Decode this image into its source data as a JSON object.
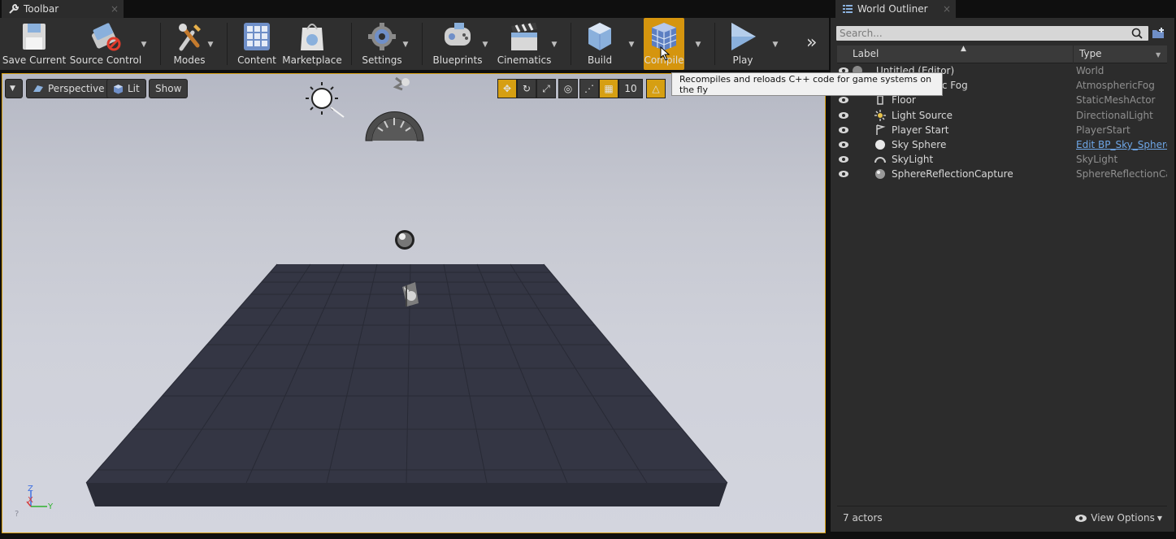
{
  "left_tab": {
    "title": "Toolbar",
    "close": "×"
  },
  "right_tab": {
    "title": "World Outliner",
    "close": "×"
  },
  "toolbar": {
    "buttons": [
      {
        "label": "Save Current",
        "icon": "save-icon"
      },
      {
        "label": "Source Control",
        "icon": "source-control-icon"
      },
      {
        "label": "Modes",
        "icon": "modes-icon"
      },
      {
        "label": "Content",
        "icon": "content-icon"
      },
      {
        "label": "Marketplace",
        "icon": "marketplace-icon"
      },
      {
        "label": "Settings",
        "icon": "settings-icon"
      },
      {
        "label": "Blueprints",
        "icon": "blueprints-icon"
      },
      {
        "label": "Cinematics",
        "icon": "cinematics-icon"
      },
      {
        "label": "Build",
        "icon": "build-icon"
      },
      {
        "label": "Compile",
        "icon": "compile-icon"
      },
      {
        "label": "Play",
        "icon": "play-icon"
      }
    ],
    "overflow": "»",
    "tooltip": "Recompiles and reloads C++ code for game systems on the fly"
  },
  "viewport": {
    "view_mode": "Perspective",
    "lighting": "Lit",
    "show": "Show",
    "grid_value": "10",
    "axis": {
      "z": "Z",
      "x": "X",
      "y": "Y"
    },
    "help": "?"
  },
  "outliner": {
    "search_placeholder": "Search...",
    "col_label": "Label",
    "col_type": "Type",
    "rows": [
      {
        "label": "Untitled (Editor)",
        "type": "World"
      },
      {
        "label": "Atmospheric Fog",
        "type": "AtmosphericFog"
      },
      {
        "label": "Floor",
        "type": "StaticMeshActor"
      },
      {
        "label": "Light Source",
        "type": "DirectionalLight"
      },
      {
        "label": "Player Start",
        "type": "PlayerStart"
      },
      {
        "label": "Sky Sphere",
        "type": "Edit BP_Sky_Sphere"
      },
      {
        "label": "SkyLight",
        "type": "SkyLight"
      },
      {
        "label": "SphereReflectionCapture",
        "type": "SphereReflectionCapture"
      }
    ],
    "actor_count": "7 actors",
    "view_options": "View Options"
  },
  "colors": {
    "accent": "#d69f12",
    "panel": "#2c2c2c",
    "link": "#6ea6e6"
  }
}
